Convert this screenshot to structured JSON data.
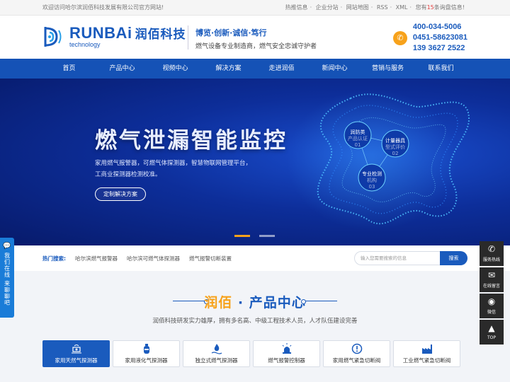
{
  "topbar": {
    "welcome": "欢迎访问哈尔滨润佰科技发展有限公司官方网站!",
    "links": [
      "热推信息",
      "企业分站",
      "网站地图",
      "RSS",
      "XML"
    ],
    "notice_prefix": "您有",
    "notice_count": "15",
    "notice_suffix": "条询盘信息!"
  },
  "header": {
    "logo_en": "RUNBAi",
    "logo_cn": "润佰科技",
    "logo_sub": "technology",
    "slogan_main": "博览·创新·诚信·笃行",
    "slogan_sub": "燃气设备专业制造商，燃气安全忠诚守护者",
    "phones": [
      "400-034-5006",
      "0451-58623081",
      "139 3627 2522"
    ],
    "phone_icon": "phone-icon"
  },
  "nav": {
    "items": [
      "首页",
      "产品中心",
      "视频中心",
      "解决方案",
      "走进润佰",
      "新闻中心",
      "营销与服务",
      "联系我们"
    ]
  },
  "banner": {
    "title": "燃气泄漏智能监控",
    "desc_line1": "家用燃气报警器，可燃气体探测器，智慧物联网管理平台，",
    "desc_line2": "工商业探测器检测校准。",
    "cta": "定制解决方案",
    "nodes": [
      {
        "name": "润防类",
        "sub": "产品认证",
        "num": "01"
      },
      {
        "name": "计量器具",
        "sub": "型式评价",
        "num": "02"
      },
      {
        "name": "专业检测",
        "sub": "机构",
        "num": "03"
      }
    ],
    "colors": {
      "accent": "#f7a21b",
      "primary": "#1a5bbd"
    }
  },
  "search": {
    "hot_label": "热门搜索:",
    "hot_items": [
      "哈尔滨燃气报警器",
      "哈尔滨可燃气体探测器",
      "燃气报警切断装置"
    ],
    "placeholder": "输入您需要搜索的信息",
    "button": "搜索"
  },
  "products": {
    "title_highlight": "润佰",
    "title_rest": " · 产品中心",
    "subtitle": "润佰科技研发实力雄厚，拥有多名高、中级工程技术人员，人才队伍建设完善",
    "tabs": [
      {
        "label": "家用天然气探测器",
        "icon": "sensor-icon",
        "active": true
      },
      {
        "label": "家用液化气探测器",
        "icon": "gas-tank-icon",
        "active": false
      },
      {
        "label": "独立式燃气探测器",
        "icon": "flame-icon",
        "active": false
      },
      {
        "label": "燃气报警控制器",
        "icon": "alarm-light-icon",
        "active": false
      },
      {
        "label": "家用燃气紧急切断阀",
        "icon": "warning-circle-icon",
        "active": false
      },
      {
        "label": "工业燃气紧急切断阀",
        "icon": "factory-icon",
        "active": false
      }
    ]
  },
  "left_float": {
    "text1": "我们在线",
    "text2": "来聊聊吧"
  },
  "right_float": {
    "items": [
      {
        "label": "服务热线",
        "icon": "phone-icon",
        "glyph": "✆"
      },
      {
        "label": "在线留言",
        "icon": "message-icon",
        "glyph": "✉"
      },
      {
        "label": "微信",
        "icon": "wechat-icon",
        "glyph": "◉"
      },
      {
        "label": "TOP",
        "icon": "arrow-up-icon",
        "glyph": "▲"
      }
    ]
  }
}
